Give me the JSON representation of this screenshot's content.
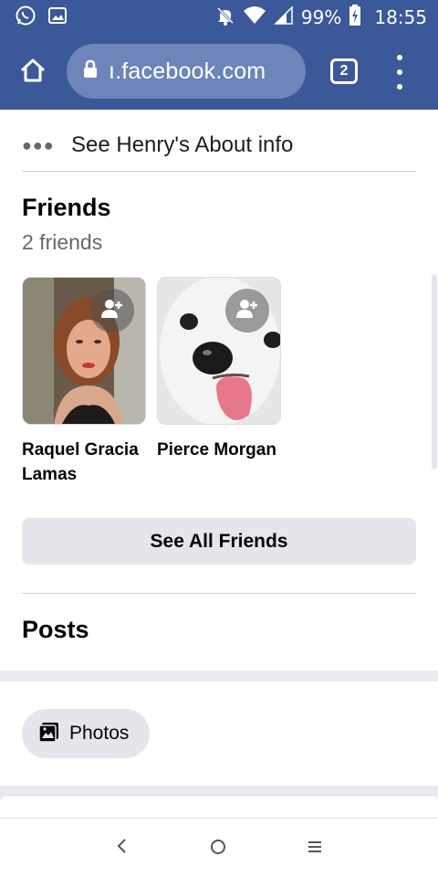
{
  "status_bar": {
    "battery_percent": "99%",
    "time": "18:55",
    "icons": [
      "whatsapp-icon",
      "image-icon",
      "mute-icon",
      "wifi-icon",
      "signal-icon",
      "battery-charging-icon"
    ]
  },
  "browser": {
    "url": "ı.facebook.com",
    "tab_count": "2",
    "icons": [
      "home-icon",
      "lock-icon",
      "tabs-icon",
      "more-menu-icon"
    ]
  },
  "about": {
    "label": "See Henry's About info",
    "icon": "more-dots-icon"
  },
  "friends": {
    "title": "Friends",
    "count": "2 friends",
    "items": [
      {
        "name": "Raquel Gracia Lamas"
      },
      {
        "name": "Pierce Morgan"
      }
    ],
    "see_all_label": "See All Friends"
  },
  "posts": {
    "title": "Posts"
  },
  "photos": {
    "label": "Photos",
    "icon": "photos-icon"
  },
  "nav": {
    "icons": [
      "back-icon",
      "home-circle-icon",
      "recent-apps-icon"
    ]
  },
  "colors": {
    "brand_blue": "#3b5998",
    "url_pill": "#6d85b9",
    "button_gray": "#e4e6eb",
    "secondary_text": "#65676b"
  }
}
